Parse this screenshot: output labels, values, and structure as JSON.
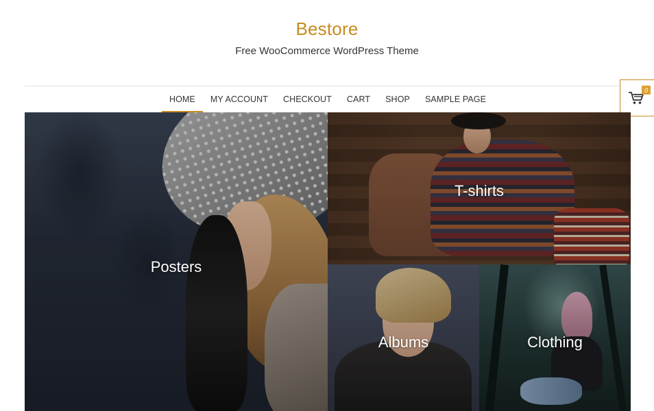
{
  "site": {
    "title": "Bestore",
    "tagline": "Free WooCommerce WordPress Theme"
  },
  "nav": {
    "items": [
      {
        "label": "HOME",
        "active": true
      },
      {
        "label": "MY ACCOUNT",
        "active": false
      },
      {
        "label": "CHECKOUT",
        "active": false
      },
      {
        "label": "CART",
        "active": false
      },
      {
        "label": "SHOP",
        "active": false
      },
      {
        "label": "SAMPLE PAGE",
        "active": false
      }
    ]
  },
  "cart": {
    "icon": "shopping-cart-icon",
    "count": "0"
  },
  "categories": [
    {
      "name": "Posters"
    },
    {
      "name": "T-shirts"
    },
    {
      "name": "Albums"
    },
    {
      "name": "Clothing"
    }
  ],
  "colors": {
    "accent": "#c88b1e",
    "badge": "#dca033",
    "text": "#333333"
  }
}
